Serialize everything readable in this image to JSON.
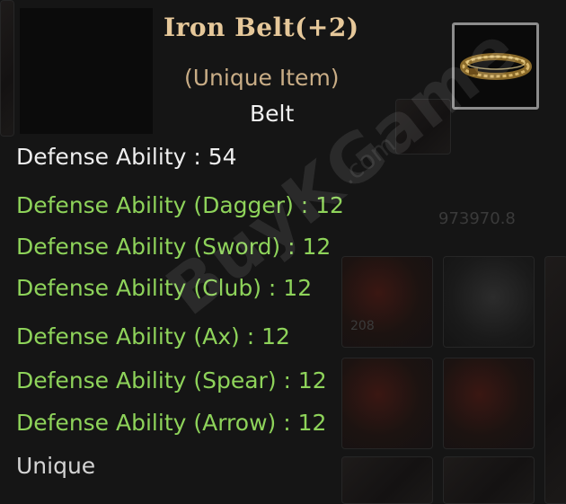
{
  "item": {
    "name": "Iron Belt(+2)",
    "rarity": "(Unique Item)",
    "type": "Belt",
    "icon": "belt-icon",
    "base_stat": "Defense Ability : 54",
    "bonus_stats": [
      "Defense Ability (Dagger) : 12",
      "Defense Ability (Sword) : 12",
      "Defense Ability (Club) : 12",
      "Defense Ability (Ax) : 12",
      "Defense Ability (Spear) : 12",
      "Defense Ability (Arrow) : 12"
    ],
    "grade": "Unique"
  },
  "background": {
    "ghost_number": "973970.8",
    "slot_count": "208"
  },
  "watermark": {
    "text": "BuyKGame",
    "sub": ".com"
  },
  "colors": {
    "title": "#e6c89a",
    "rarity": "#c9ad86",
    "bonus": "#8ed35a",
    "base": "#eeeeee"
  }
}
